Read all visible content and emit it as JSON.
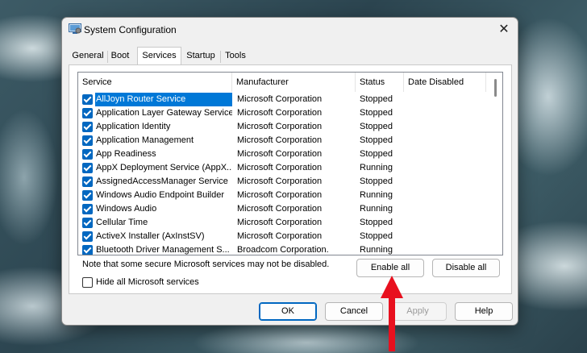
{
  "window": {
    "title": "System Configuration"
  },
  "tabs": [
    {
      "label": "General",
      "active": false
    },
    {
      "label": "Boot",
      "active": false
    },
    {
      "label": "Services",
      "active": true
    },
    {
      "label": "Startup",
      "active": false
    },
    {
      "label": "Tools",
      "active": false
    }
  ],
  "listview": {
    "columns": [
      "Service",
      "Manufacturer",
      "Status",
      "Date Disabled"
    ],
    "rows": [
      {
        "checked": true,
        "service": "AllJoyn Router Service",
        "manufacturer": "Microsoft Corporation",
        "status": "Stopped",
        "date_disabled": ""
      },
      {
        "checked": true,
        "service": "Application Layer Gateway Service",
        "manufacturer": "Microsoft Corporation",
        "status": "Stopped",
        "date_disabled": ""
      },
      {
        "checked": true,
        "service": "Application Identity",
        "manufacturer": "Microsoft Corporation",
        "status": "Stopped",
        "date_disabled": ""
      },
      {
        "checked": true,
        "service": "Application Management",
        "manufacturer": "Microsoft Corporation",
        "status": "Stopped",
        "date_disabled": ""
      },
      {
        "checked": true,
        "service": "App Readiness",
        "manufacturer": "Microsoft Corporation",
        "status": "Stopped",
        "date_disabled": ""
      },
      {
        "checked": true,
        "service": "AppX Deployment Service (AppX...",
        "manufacturer": "Microsoft Corporation",
        "status": "Running",
        "date_disabled": ""
      },
      {
        "checked": true,
        "service": "AssignedAccessManager Service",
        "manufacturer": "Microsoft Corporation",
        "status": "Stopped",
        "date_disabled": ""
      },
      {
        "checked": true,
        "service": "Windows Audio Endpoint Builder",
        "manufacturer": "Microsoft Corporation",
        "status": "Running",
        "date_disabled": ""
      },
      {
        "checked": true,
        "service": "Windows Audio",
        "manufacturer": "Microsoft Corporation",
        "status": "Running",
        "date_disabled": ""
      },
      {
        "checked": true,
        "service": "Cellular Time",
        "manufacturer": "Microsoft Corporation",
        "status": "Stopped",
        "date_disabled": ""
      },
      {
        "checked": true,
        "service": "ActiveX Installer (AxInstSV)",
        "manufacturer": "Microsoft Corporation",
        "status": "Stopped",
        "date_disabled": ""
      },
      {
        "checked": true,
        "service": "Bluetooth Driver Management S...",
        "manufacturer": "Broadcom Corporation.",
        "status": "Running",
        "date_disabled": ""
      }
    ]
  },
  "note": "Note that some secure Microsoft services may not be disabled.",
  "buttons": {
    "enable_all": "Enable all",
    "disable_all": "Disable all",
    "ok": "OK",
    "cancel": "Cancel",
    "apply": "Apply",
    "help": "Help"
  },
  "hide_ms_services": {
    "label": "Hide all Microsoft services",
    "checked": false
  },
  "close_glyph": "✕",
  "colors": {
    "selection": "#0078d7",
    "checkbox": "#0067c0",
    "annotation_arrow": "#e8101e"
  },
  "annotation": {
    "icon": "up-arrow-icon"
  }
}
